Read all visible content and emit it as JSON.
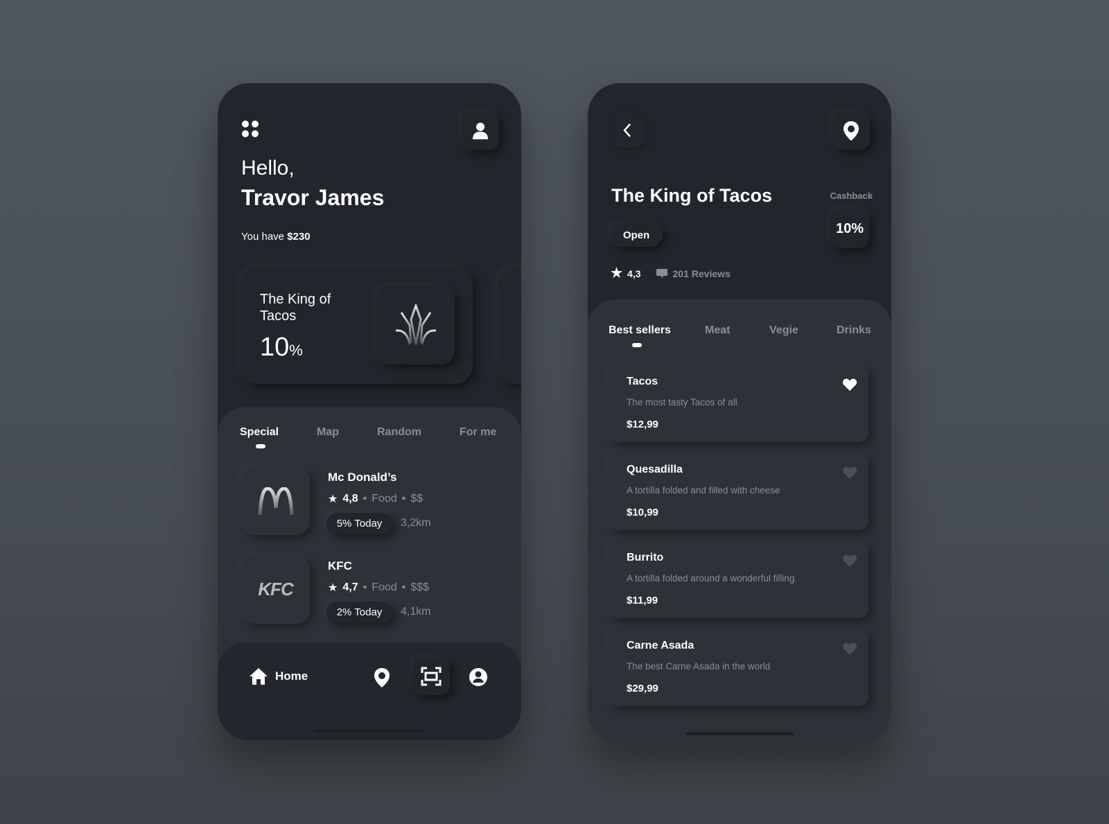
{
  "home": {
    "greeting": "Hello,",
    "user_name": "Travor James",
    "balance_prefix": "You have",
    "balance": "$230",
    "featured": {
      "name": "The King of Tacos",
      "value": "10",
      "unit": "%"
    },
    "tabs": [
      {
        "label": "Special",
        "active": true
      },
      {
        "label": "Map"
      },
      {
        "label": "Random"
      },
      {
        "label": "For me"
      }
    ],
    "restaurants": [
      {
        "name": "Mc Donald’s",
        "logo": "M",
        "rating": "4,8",
        "category": "Food",
        "price": "$$",
        "discount": "5% Today",
        "distance": "3,2km"
      },
      {
        "name": "KFC",
        "logo": "KFC",
        "rating": "4,7",
        "category": "Food",
        "price": "$$$",
        "discount": "2% Today",
        "distance": "4,1km"
      }
    ],
    "nav": {
      "home_label": "Home",
      "icons": [
        "home-icon",
        "location-pin-icon",
        "scan-icon",
        "profile-circle-icon"
      ]
    }
  },
  "detail": {
    "title": "The King of Tacos",
    "status": "Open",
    "cashback_label": "Cashback",
    "cashback_value": "10%",
    "rating": "4,3",
    "reviews": "201 Reviews",
    "tabs": [
      {
        "label": "Best sellers",
        "active": true
      },
      {
        "label": "Meat"
      },
      {
        "label": "Vegie"
      },
      {
        "label": "Drinks"
      }
    ],
    "items": [
      {
        "name": "Tacos",
        "description": "The most tasty Tacos of all",
        "price": "$12,99",
        "favorite": true
      },
      {
        "name": "Quesadilla",
        "description": "A tortilla folded and filled with cheese",
        "price": "$10,99",
        "favorite": false
      },
      {
        "name": "Burrito",
        "description": "A tortilla folded around a wonderful filling",
        "price": "$11,99",
        "favorite": false
      },
      {
        "name": "Carne Asada",
        "description": "The best Carne Asada in the world",
        "price": "$29,99",
        "favorite": false
      }
    ]
  },
  "colors": {
    "phone_bg": "#22262c",
    "panel_bg": "#2d3239",
    "muted_text": "#8a8f96",
    "heart_inactive": "#4a4f56"
  }
}
